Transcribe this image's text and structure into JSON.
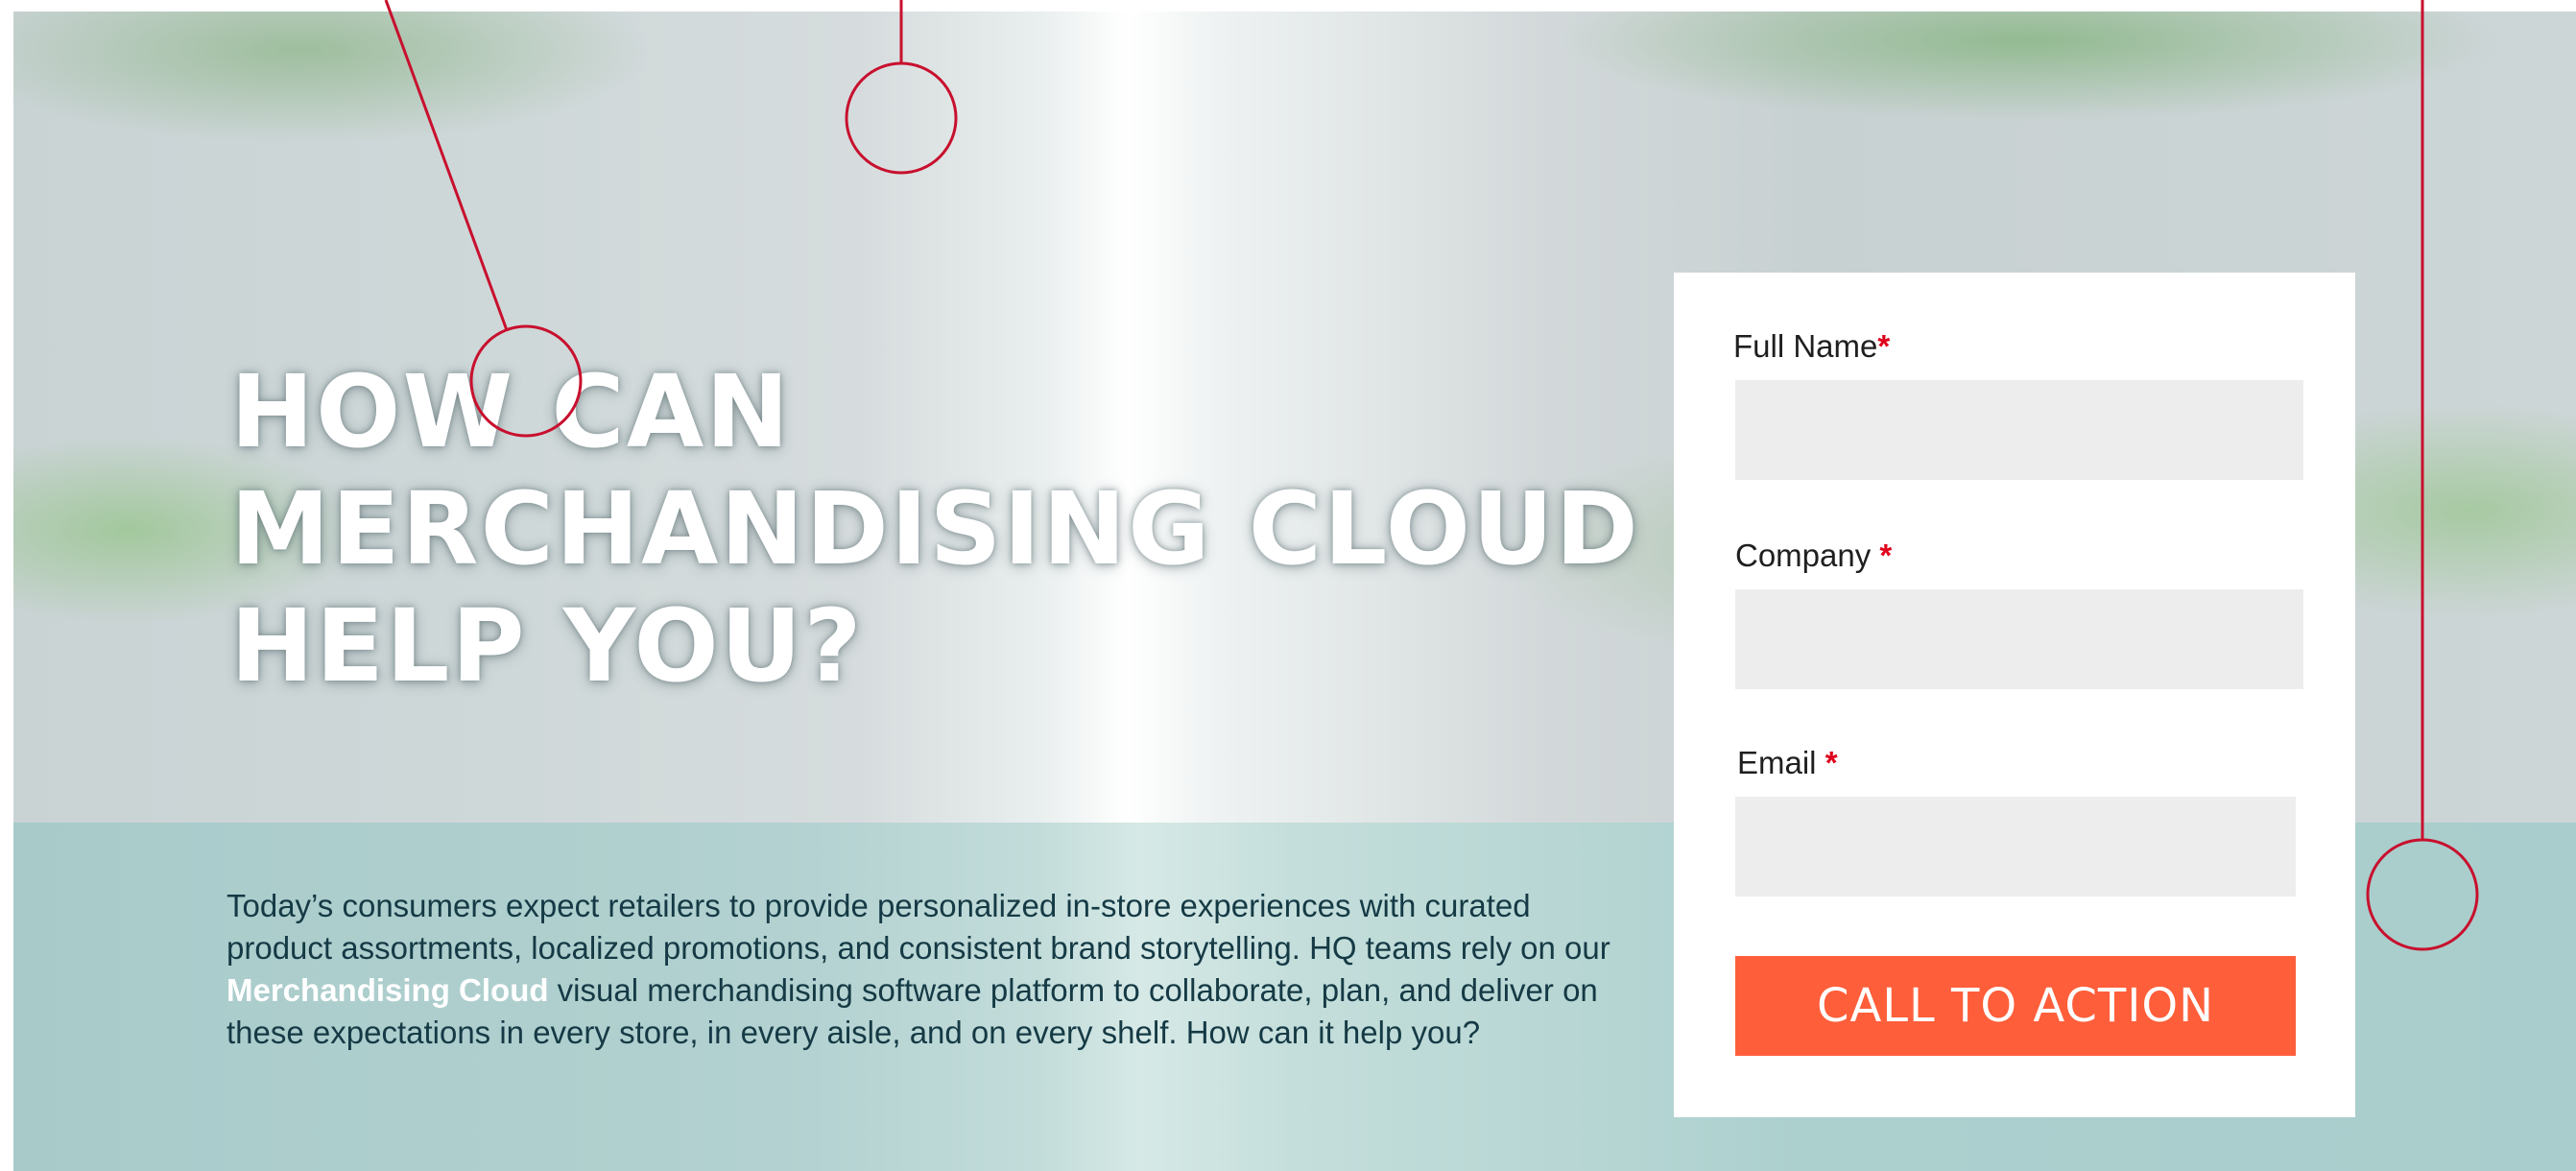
{
  "hero": {
    "headline_line1": "HOW CAN",
    "headline_line2": "MERCHANDISING CLOUD",
    "headline_line3": "HELP YOU?",
    "intro_before": "Today’s consumers expect retailers to provide personalized in-store experiences with curated product assortments, localized promotions, and consistent brand storytelling. HQ teams rely on our ",
    "intro_highlight": "Merchandising Cloud",
    "intro_after": " visual merchandising software platform to collaborate, plan, and deliver on these expectations in every store, in every aisle, and on every shelf. How can it help you?"
  },
  "form": {
    "full_name_label": "Full Name",
    "company_label": "Company ",
    "email_label": "Email ",
    "required_marker": "*",
    "full_name_value": "",
    "company_value": "",
    "email_value": "",
    "submit_label": "CALL TO ACTION"
  },
  "colors": {
    "accent": "#ff5e3a",
    "required": "#e0001b",
    "annotation": "#c8102e",
    "body_text": "#153a45"
  }
}
